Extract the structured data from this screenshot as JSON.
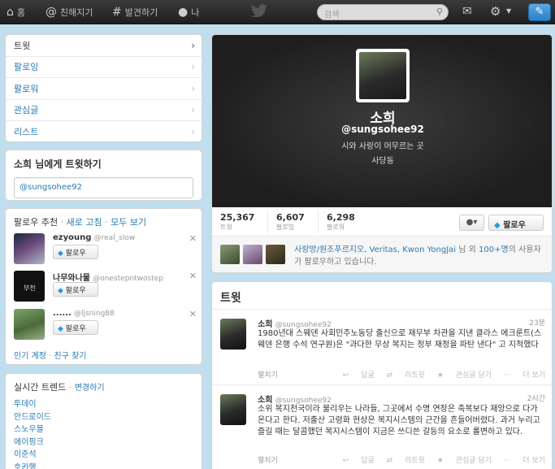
{
  "nav": {
    "home": "홈",
    "connect": "친해지기",
    "discover": "발견하기",
    "me": "나",
    "search_placeholder": "검색"
  },
  "sidebar": {
    "items": [
      {
        "label": "트윗"
      },
      {
        "label": "팔로잉"
      },
      {
        "label": "팔로워"
      },
      {
        "label": "관심글"
      },
      {
        "label": "리스트"
      }
    ]
  },
  "tweet_to": {
    "title": "소희 님에게 트윗하기",
    "value": "@sungsohee92"
  },
  "who_to_follow": {
    "title": "팔로우 추천",
    "refresh": "새로 고침",
    "view_all": "모두 보기",
    "suggestions": [
      {
        "name": "ezyoung",
        "handle": "@real_slow",
        "button": "팔로우"
      },
      {
        "name": "나무와나물",
        "handle": "@onestepntwostep",
        "button": "팔로우"
      },
      {
        "name": "......",
        "handle": "@ljsning88",
        "button": "팔로우"
      }
    ],
    "popular": "인기 계정",
    "find_friends": "친구 찾기"
  },
  "trends": {
    "title": "실시간 트렌드",
    "change": "변경하기",
    "items": [
      "투데이",
      "안드로이드",
      "스노우볼",
      "에이핑크",
      "이준석",
      "호카행"
    ]
  },
  "profile": {
    "name": "소희",
    "handle": "@sungsohee92",
    "bio": "시와 사랑이 머무르는 곳",
    "location": "사당동",
    "stats": [
      {
        "value": "25,367",
        "label": "트윗"
      },
      {
        "value": "6,607",
        "label": "팔로잉"
      },
      {
        "value": "6,298",
        "label": "팔로워"
      }
    ],
    "user_menu": "▾",
    "follow_button": "팔로우",
    "followed_by": {
      "names": "사랑방/원조푸르지오, Veritas, Kwon YongJai",
      "middle": "님 외",
      "more": "100+명",
      "suffix": "의 사용자가 팔로우하고 있습니다."
    }
  },
  "tweets": {
    "title": "트윗",
    "items": [
      {
        "name": "소희",
        "handle": "@sungsohee92",
        "time": "23분",
        "text": "1980년대 스웨덴 사회민주노동당 출신으로 재무부 차관을 지낸 클라스 에크룬트(스웨덴 은행 수석 연구원)은 \"과다한 무상 복지는 정부 재정을 파탄 낸다\" 고 지적했다",
        "expand": "펼치기",
        "actions": [
          "답글",
          "리트윗",
          "관심글 담기",
          "더 보기"
        ]
      },
      {
        "name": "소희",
        "handle": "@sungsohee92",
        "time": "2시간",
        "text": "소위 복지천국이라 불리우는 나라들, 그곳에서 수명 연장은 축복보다 재앙으로 다가온다고 한다. 저출산 고령화 현상은 복지시스템의 근간을 흔들어버렸다. 과거 누리고 즐길 때는 달콤했던 복지시스템이 지금은 쓰디쓴 갈등의 요소로 롤변하고 있다.",
        "expand": "펼치기",
        "actions": [
          "답글",
          "리트윗",
          "관심글 담기",
          "더 보기"
        ]
      }
    ]
  }
}
